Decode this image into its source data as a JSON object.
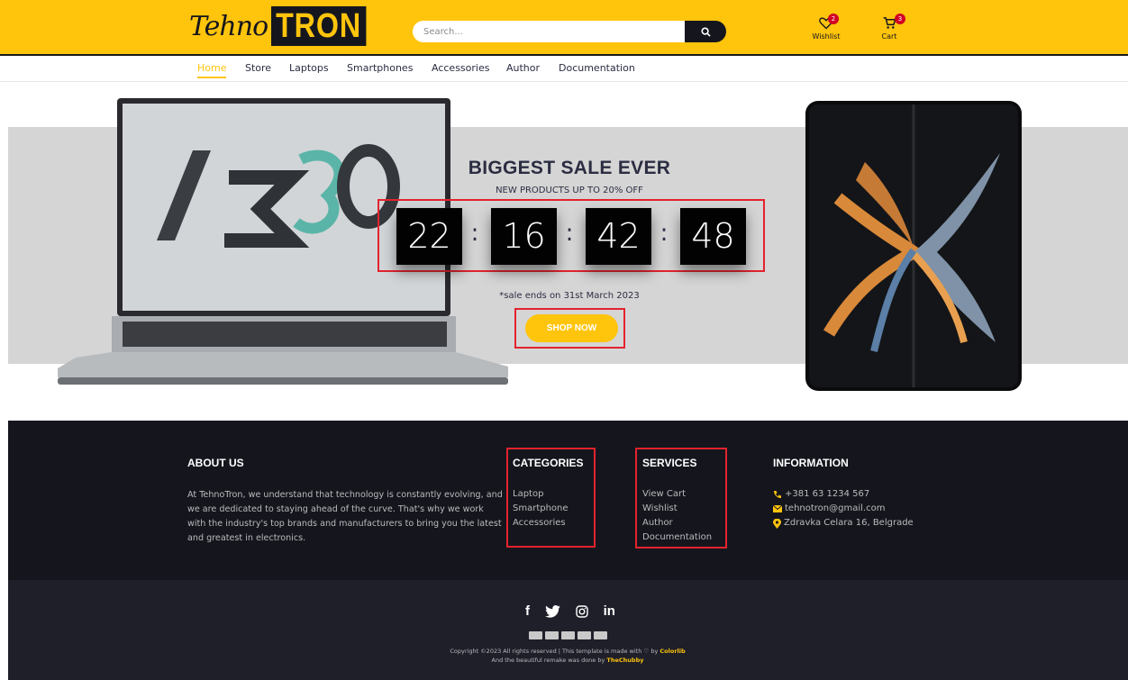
{
  "header": {
    "logo_script": "Tehno",
    "logo_box": "TRON",
    "search_placeholder": "Search...",
    "wishlist": {
      "label": "Wishlist",
      "count": "2"
    },
    "cart": {
      "label": "Cart",
      "count": "3"
    }
  },
  "nav": {
    "items": [
      "Home",
      "Store",
      "Laptops",
      "Smartphones",
      "Accessories",
      "Author",
      "Documentation"
    ],
    "active": "Home"
  },
  "hero": {
    "title": "BIGGEST SALE EVER",
    "subtitle": "NEW PRODUCTS UP TO 20% OFF",
    "countdown": [
      "22",
      "16",
      "42",
      "48"
    ],
    "separator": ":",
    "sale_ends": "*sale ends on 31st March 2023",
    "button": "SHOP NOW",
    "laptop_screen_text": "AERO"
  },
  "footer": {
    "about": {
      "heading": "ABOUT US",
      "text": "At TehnoTron, we understand that technology is constantly evolving, and we are dedicated to staying ahead of the curve. That's why we work with the industry's top brands and manufacturers to bring you the latest and greatest in electronics."
    },
    "categories": {
      "heading": "CATEGORIES",
      "items": [
        "Laptop",
        "Smartphone",
        "Accessories"
      ]
    },
    "services": {
      "heading": "SERVICES",
      "items": [
        "View Cart",
        "Wishlist",
        "Author",
        "Documentation"
      ]
    },
    "information": {
      "heading": "INFORMATION",
      "phone": "+381 63 1234 567",
      "email": "tehnotron@gmail.com",
      "address": "Zdravka Celara 16, Belgrade"
    },
    "socials": [
      "f",
      "twitter",
      "instagram",
      "in"
    ],
    "copyright_line1": "Copyright ©2023 All rights reserved | This template is made with",
    "copyright_by": "by",
    "copyright_colorlib": "Colorlib",
    "copyright_line2": "And the beautiful remake was done by",
    "copyright_chubby": "TheChubby"
  },
  "colors": {
    "accent": "#ffc40c",
    "dark": "#15161d",
    "highlight": "#e3232e",
    "badge": "#d10024"
  }
}
